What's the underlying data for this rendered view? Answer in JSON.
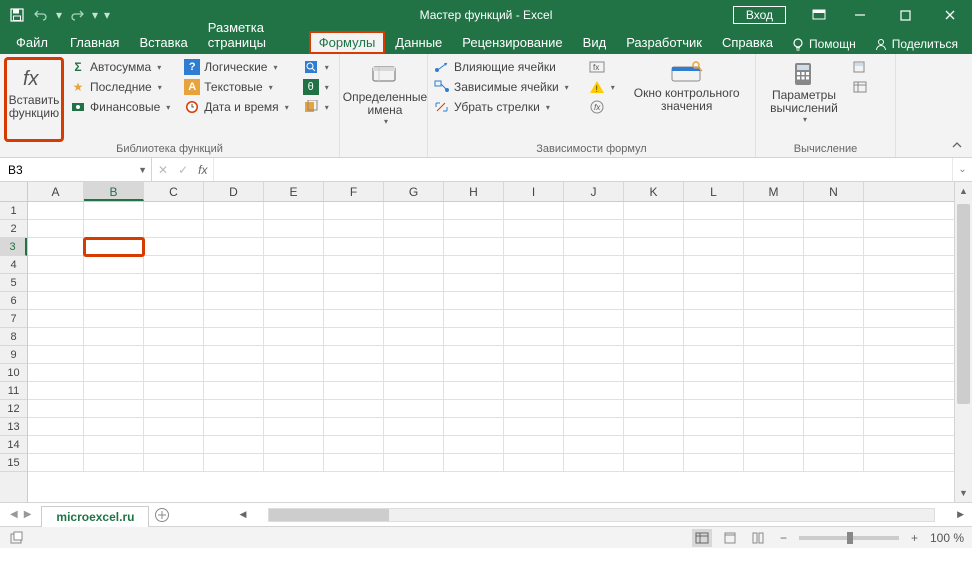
{
  "title": "Мастер функций  -  Excel",
  "signin": "Вход",
  "tabs": [
    "Файл",
    "Главная",
    "Вставка",
    "Разметка страницы",
    "Формулы",
    "Данные",
    "Рецензирование",
    "Вид",
    "Разработчик",
    "Справка"
  ],
  "active_tab_index": 4,
  "tell_me": "Помощн",
  "share": "Поделиться",
  "ribbon": {
    "insert_fn": "Вставить\nфункцию",
    "lib": {
      "autosum": "Автосумма",
      "recent": "Последние",
      "financial": "Финансовые",
      "logical": "Логические",
      "text": "Текстовые",
      "date": "Дата и время",
      "lookup": "",
      "math": "",
      "more": "",
      "label": "Библиотека функций"
    },
    "names": {
      "defined": "Определенные\nимена",
      "label": ""
    },
    "audit": {
      "precedents": "Влияющие ячейки",
      "dependents": "Зависимые ячейки",
      "remove": "Убрать стрелки",
      "watch": "Окно контрольного\nзначения",
      "label": "Зависимости формул"
    },
    "calc": {
      "options": "Параметры\nвычислений",
      "label": "Вычисление"
    }
  },
  "namebox": "B3",
  "columns": [
    "A",
    "B",
    "C",
    "D",
    "E",
    "F",
    "G",
    "H",
    "I",
    "J",
    "K",
    "L",
    "M",
    "N"
  ],
  "rows": [
    1,
    2,
    3,
    4,
    5,
    6,
    7,
    8,
    9,
    10,
    11,
    12,
    13,
    14,
    15
  ],
  "selected": {
    "col": 1,
    "row": 2
  },
  "sheet": "microexcel.ru",
  "zoom": "100 %"
}
